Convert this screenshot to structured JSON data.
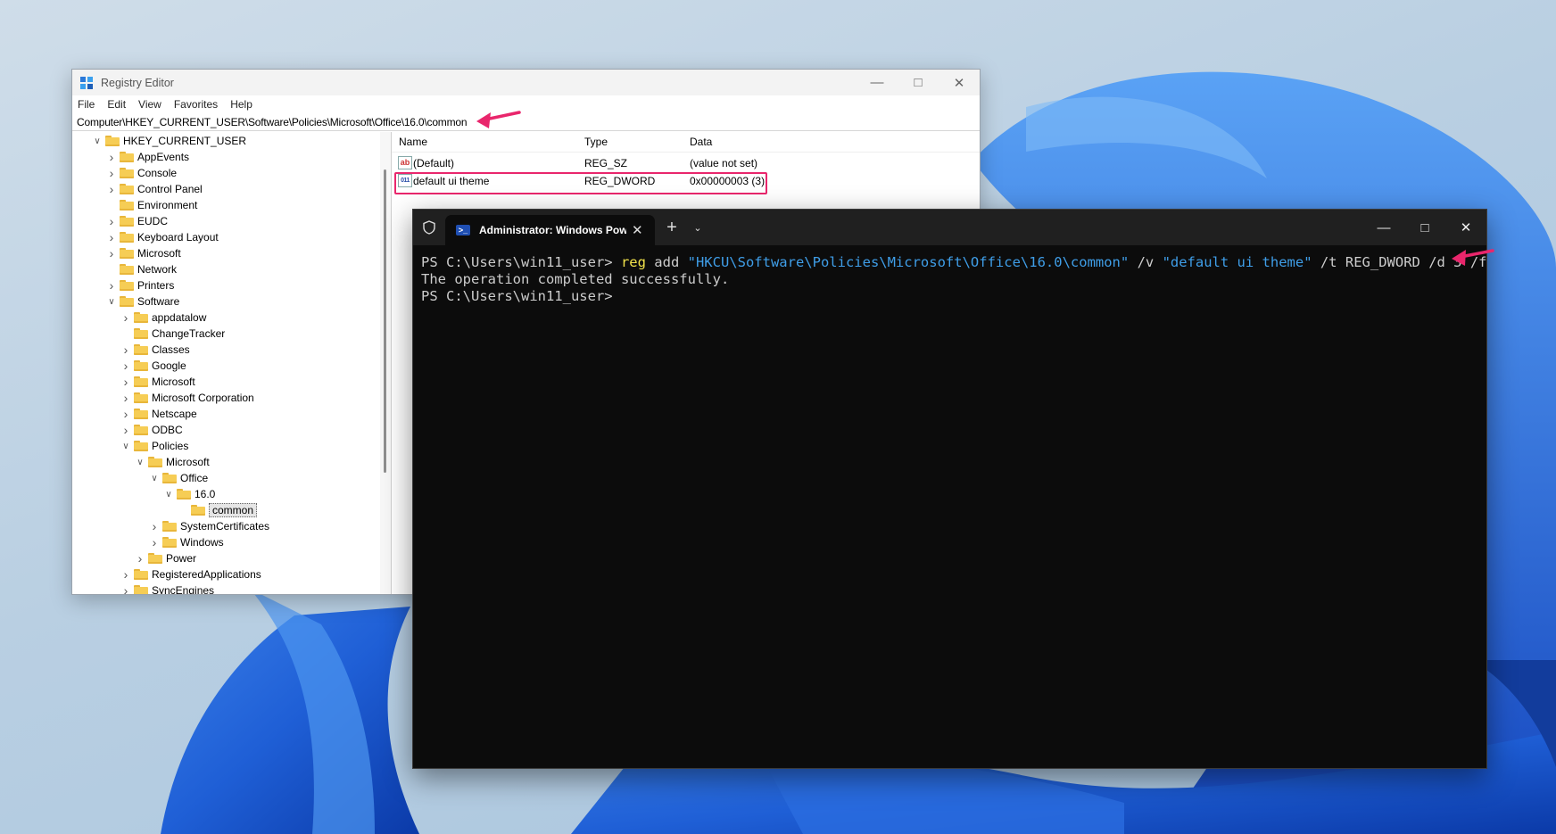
{
  "regedit": {
    "title": "Registry Editor",
    "menu": [
      "File",
      "Edit",
      "View",
      "Favorites",
      "Help"
    ],
    "address": "Computer\\HKEY_CURRENT_USER\\Software\\Policies\\Microsoft\\Office\\16.0\\common",
    "tree": [
      {
        "label": "HKEY_CURRENT_USER",
        "level": 0,
        "chevron": "open"
      },
      {
        "label": "AppEvents",
        "level": 1,
        "chevron": "closed"
      },
      {
        "label": "Console",
        "level": 1,
        "chevron": "closed"
      },
      {
        "label": "Control Panel",
        "level": 1,
        "chevron": "closed"
      },
      {
        "label": "Environment",
        "level": 1,
        "chevron": "none"
      },
      {
        "label": "EUDC",
        "level": 1,
        "chevron": "closed"
      },
      {
        "label": "Keyboard Layout",
        "level": 1,
        "chevron": "closed"
      },
      {
        "label": "Microsoft",
        "level": 1,
        "chevron": "closed"
      },
      {
        "label": "Network",
        "level": 1,
        "chevron": "none"
      },
      {
        "label": "Printers",
        "level": 1,
        "chevron": "closed"
      },
      {
        "label": "Software",
        "level": 1,
        "chevron": "open"
      },
      {
        "label": "appdatalow",
        "level": 2,
        "chevron": "closed"
      },
      {
        "label": "ChangeTracker",
        "level": 2,
        "chevron": "none"
      },
      {
        "label": "Classes",
        "level": 2,
        "chevron": "closed"
      },
      {
        "label": "Google",
        "level": 2,
        "chevron": "closed"
      },
      {
        "label": "Microsoft",
        "level": 2,
        "chevron": "closed"
      },
      {
        "label": "Microsoft Corporation",
        "level": 2,
        "chevron": "closed"
      },
      {
        "label": "Netscape",
        "level": 2,
        "chevron": "closed"
      },
      {
        "label": "ODBC",
        "level": 2,
        "chevron": "closed"
      },
      {
        "label": "Policies",
        "level": 2,
        "chevron": "open"
      },
      {
        "label": "Microsoft",
        "level": 3,
        "chevron": "open"
      },
      {
        "label": "Office",
        "level": 4,
        "chevron": "open"
      },
      {
        "label": "16.0",
        "level": 5,
        "chevron": "open"
      },
      {
        "label": "common",
        "level": 6,
        "chevron": "none",
        "selected": true
      },
      {
        "label": "SystemCertificates",
        "level": 4,
        "chevron": "closed"
      },
      {
        "label": "Windows",
        "level": 4,
        "chevron": "closed"
      },
      {
        "label": "Power",
        "level": 3,
        "chevron": "closed"
      },
      {
        "label": "RegisteredApplications",
        "level": 2,
        "chevron": "closed"
      },
      {
        "label": "SyncEngines",
        "level": 2,
        "chevron": "closed"
      }
    ],
    "columns": {
      "name": "Name",
      "type": "Type",
      "data": "Data"
    },
    "values": [
      {
        "name": "(Default)",
        "type": "REG_SZ",
        "data": "(value not set)",
        "icon": "ab-string-icon"
      },
      {
        "name": "default ui theme",
        "type": "REG_DWORD",
        "data": "0x00000003 (3)",
        "icon": "binary-dword-icon",
        "highlighted": true
      }
    ]
  },
  "terminal": {
    "tab_title": "Administrator: Windows PowerShell",
    "lines": [
      {
        "prompt": "PS C:\\Users\\win11_user> ",
        "cmd": "reg",
        "a1": " add ",
        "s1": "\"HKCU\\Software\\Policies\\Microsoft\\Office\\16.0\\common\"",
        "a2": " /v ",
        "s2": "\"default ui theme\"",
        "a3": " /t REG_DWORD /d 3 /f"
      }
    ],
    "output": "The operation completed successfully.",
    "prompt2": "PS C:\\Users\\win11_user>"
  },
  "colors": {
    "accent_pink": "#e9266c",
    "terminal_bg": "#0c0c0c",
    "cmd_yellow": "#f2e34b",
    "string_blue": "#3f9ee8"
  }
}
